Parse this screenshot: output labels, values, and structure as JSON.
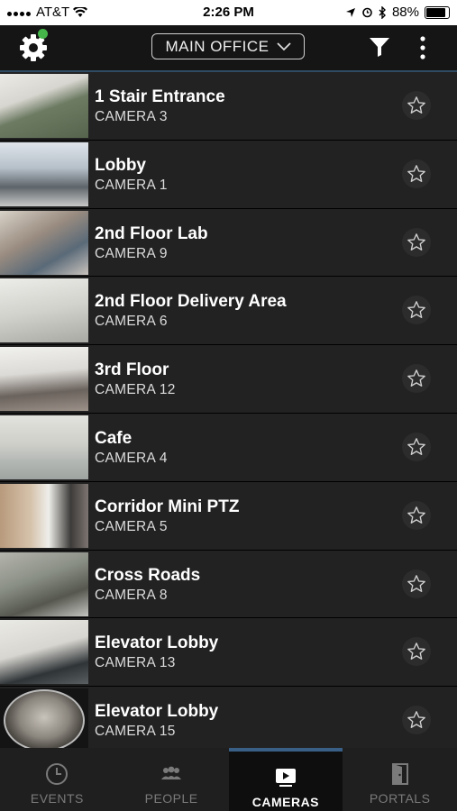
{
  "status_bar": {
    "carrier": "AT&T",
    "time": "2:26 PM",
    "battery": "88%"
  },
  "header": {
    "location": "MAIN OFFICE"
  },
  "cameras": [
    {
      "name": "1 Stair Entrance",
      "camera": "CAMERA 3"
    },
    {
      "name": "Lobby",
      "camera": "CAMERA 1"
    },
    {
      "name": "2nd Floor Lab",
      "camera": "CAMERA 9"
    },
    {
      "name": "2nd Floor Delivery Area",
      "camera": "CAMERA 6"
    },
    {
      "name": "3rd Floor",
      "camera": "CAMERA 12"
    },
    {
      "name": "Cafe",
      "camera": "CAMERA 4"
    },
    {
      "name": "Corridor Mini PTZ",
      "camera": "CAMERA 5"
    },
    {
      "name": "Cross Roads",
      "camera": "CAMERA 8"
    },
    {
      "name": "Elevator Lobby",
      "camera": "CAMERA 13"
    },
    {
      "name": "Elevator Lobby",
      "camera": "CAMERA 15"
    }
  ],
  "tabs": [
    {
      "label": "EVENTS",
      "icon": "clock-icon",
      "active": false
    },
    {
      "label": "PEOPLE",
      "icon": "people-icon",
      "active": false
    },
    {
      "label": "CAMERAS",
      "icon": "camera-icon",
      "active": true
    },
    {
      "label": "PORTALS",
      "icon": "door-icon",
      "active": false
    }
  ],
  "colors": {
    "accent": "#3a5f86",
    "notification_dot": "#45b649",
    "background": "#1b1b1b"
  }
}
